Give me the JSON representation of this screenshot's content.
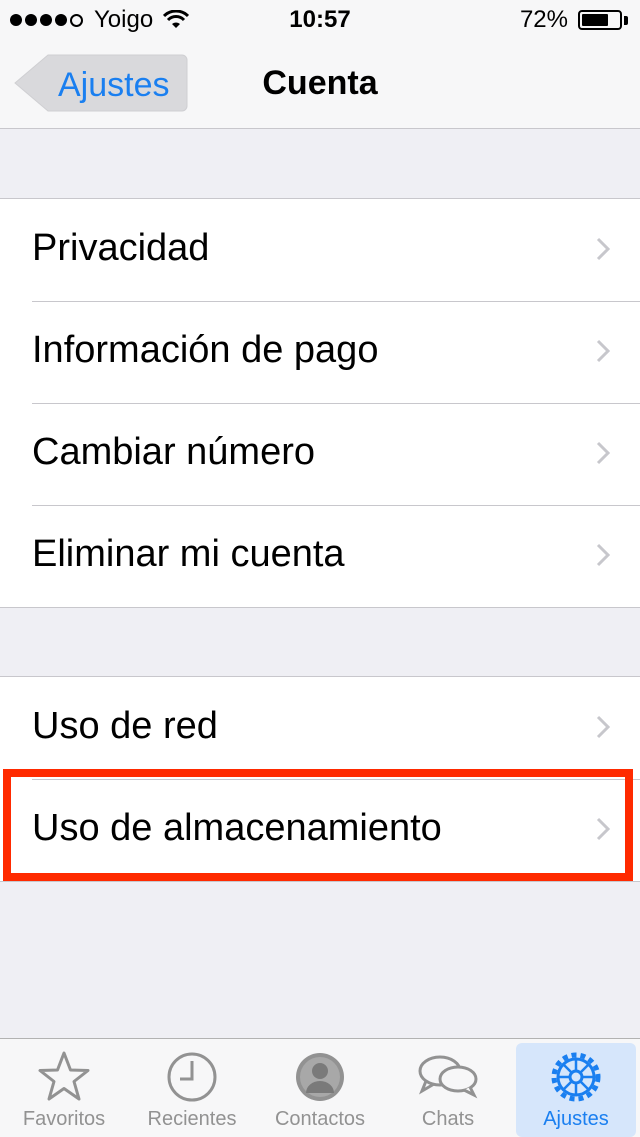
{
  "status": {
    "carrier": "Yoigo",
    "time": "10:57",
    "battery_percent": "72%",
    "battery_level": 0.72
  },
  "nav": {
    "back_label": "Ajustes",
    "title": "Cuenta"
  },
  "groups": [
    {
      "items": [
        {
          "label": "Privacidad"
        },
        {
          "label": "Información de pago"
        },
        {
          "label": "Cambiar número"
        },
        {
          "label": "Eliminar mi cuenta"
        }
      ]
    },
    {
      "items": [
        {
          "label": "Uso de red"
        },
        {
          "label": "Uso de almacenamiento",
          "highlighted": true
        }
      ]
    }
  ],
  "tabs": [
    {
      "label": "Favoritos",
      "icon": "star-icon"
    },
    {
      "label": "Recientes",
      "icon": "clock-icon"
    },
    {
      "label": "Contactos",
      "icon": "person-icon"
    },
    {
      "label": "Chats",
      "icon": "chat-bubbles-icon"
    },
    {
      "label": "Ajustes",
      "icon": "gear-icon",
      "active": true
    }
  ],
  "colors": {
    "accent": "#1a7ff0",
    "highlight_border": "#ff2a00",
    "background": "#efeff4"
  }
}
